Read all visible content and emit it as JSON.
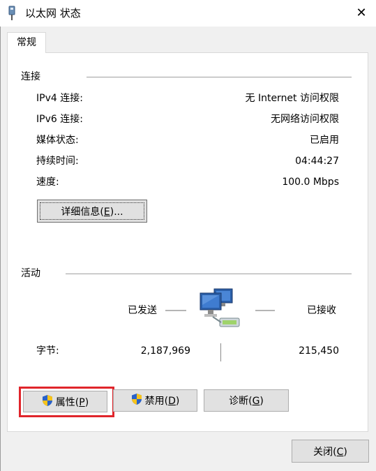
{
  "window": {
    "title": "以太网 状态",
    "close_glyph": "✕"
  },
  "tabs": [
    {
      "label": "常规"
    }
  ],
  "connection": {
    "section_title": "连接",
    "rows": [
      {
        "label": "IPv4 连接:",
        "value": "无 Internet 访问权限"
      },
      {
        "label": "IPv6 连接:",
        "value": "无网络访问权限"
      },
      {
        "label": "媒体状态:",
        "value": "已启用"
      },
      {
        "label": "持续时间:",
        "value": "04:44:27"
      },
      {
        "label": "速度:",
        "value": "100.0 Mbps"
      }
    ],
    "details_button": {
      "text": "详细信息(",
      "mnemonic": "E",
      "suffix": ")..."
    }
  },
  "activity": {
    "section_title": "活动",
    "sent_label": "已发送",
    "received_label": "已接收",
    "bytes_label": "字节:",
    "bytes_sent": "2,187,969",
    "bytes_received": "215,450",
    "network_icon": "network-computers-icon"
  },
  "buttons": {
    "properties": {
      "text": "属性(",
      "mnemonic": "P",
      "suffix": ")",
      "icon": "uac-shield-icon"
    },
    "disable": {
      "text": "禁用(",
      "mnemonic": "D",
      "suffix": ")",
      "icon": "uac-shield-icon"
    },
    "diagnose": {
      "text": "诊断(",
      "mnemonic": "G",
      "suffix": ")"
    },
    "close": {
      "text": "关闭(",
      "mnemonic": "C",
      "suffix": ")"
    }
  },
  "colors": {
    "highlight_box": "#e0252b",
    "background": "#f0f0f0",
    "panel": "#ffffff"
  }
}
